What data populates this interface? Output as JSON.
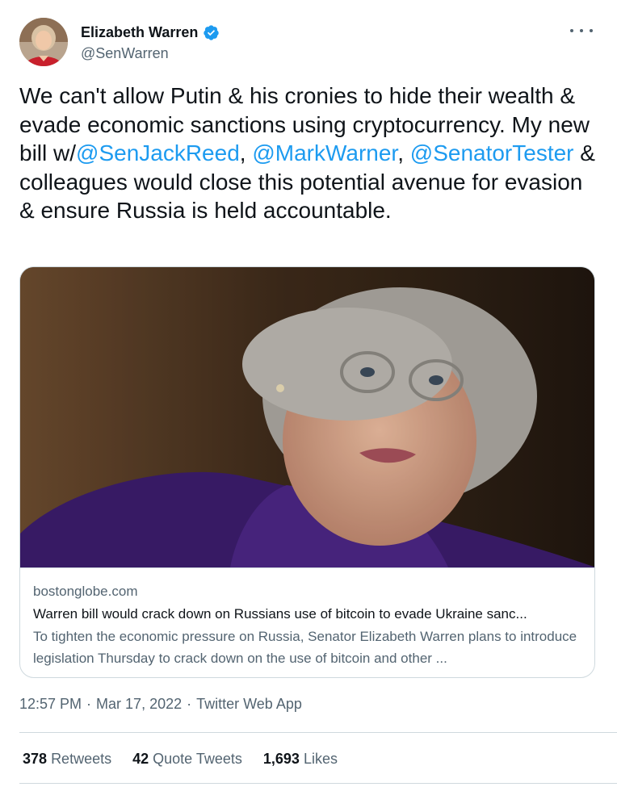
{
  "author": {
    "display_name": "Elizabeth Warren",
    "handle": "@SenWarren",
    "verified": true,
    "avatar_icon": "profile-photo",
    "verified_icon": "verified-badge-icon"
  },
  "tweet": {
    "segments": [
      {
        "text": "We can't allow Putin & his cronies to hide their wealth & evade economic sanctions using cryptocurrency. My new bill w/",
        "type": "text"
      },
      {
        "text": "@SenJackReed",
        "type": "mention"
      },
      {
        "text": ", ",
        "type": "text"
      },
      {
        "text": "@MarkWarner",
        "type": "mention"
      },
      {
        "text": ", ",
        "type": "text"
      },
      {
        "text": "@SenatorTester",
        "type": "mention"
      },
      {
        "text": " & colleagues would close this potential avenue for evasion & ensure Russia is held accountable.",
        "type": "text"
      }
    ]
  },
  "card": {
    "domain": "bostonglobe.com",
    "title": "Warren bill would crack down on Russians use of bitcoin to evade Ukraine sanc...",
    "description": "To tighten the economic pressure on Russia, Senator Elizabeth Warren plans to introduce legislation Thursday to crack down on the use of bitcoin and other ..."
  },
  "meta": {
    "time": "12:57 PM",
    "separator": "·",
    "date": "Mar 17, 2022",
    "source": "Twitter Web App"
  },
  "stats": {
    "retweets_count": "378",
    "retweets_label": "Retweets",
    "quotes_count": "42",
    "quotes_label": "Quote Tweets",
    "likes_count": "1,693",
    "likes_label": "Likes"
  },
  "colors": {
    "link": "#1d9bf0",
    "text": "#0f1419",
    "secondary": "#536471",
    "border": "#cfd9de"
  }
}
